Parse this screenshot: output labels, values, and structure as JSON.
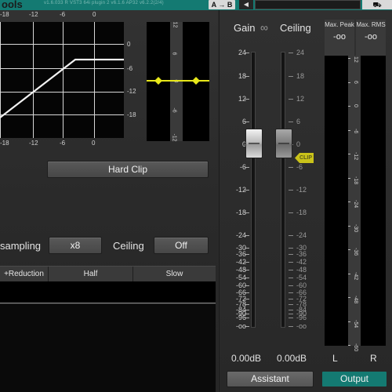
{
  "topbar": {
    "brand": "ools",
    "version": "v1.6.033 R VST3 64i plugin 2 v6.1.6 AP32 v6.2.2(2/4)",
    "ab_label": "A → B",
    "left_arrow": "◀",
    "save_icon": "⛟"
  },
  "transfer_graph": {
    "top_ticks": [
      "-18",
      "-12",
      "-6",
      "0"
    ],
    "bottom_ticks": [
      "-18",
      "-12",
      "-6",
      "0"
    ],
    "right_ticks": [
      "0",
      "-6",
      "-12",
      "-18"
    ]
  },
  "small_meter": {
    "ticks": [
      "12",
      "6",
      "0",
      "-6",
      "-12"
    ],
    "marker_color": "#e8e81a"
  },
  "clip_button": "Hard Clip",
  "oversampling": {
    "label": "sampling",
    "value": "x8"
  },
  "ceiling_switch": {
    "label": "Ceiling",
    "value": "Off"
  },
  "table_header": [
    "+Reduction",
    "Half",
    "Slow"
  ],
  "gain_ceiling": {
    "gain_label": "Gain",
    "link_icon": "∞",
    "ceiling_label": "Ceiling",
    "scale": [
      "24",
      "18",
      "12",
      "6",
      "0",
      "-6",
      "-12",
      "-18",
      "-24",
      "-30",
      "-36",
      "-42",
      "-48",
      "-54",
      "-60",
      "-66",
      "-72",
      "-78",
      "-84",
      "-90",
      "-96",
      "-oo"
    ],
    "gain_value": 0,
    "ceiling_value": 0,
    "gain_readout": "0.00dB",
    "ceiling_readout": "0.00dB",
    "clip_badge": "CLIP"
  },
  "output_meter": {
    "max_peak_label": "Max. Peak",
    "max_rms_label": "Max. RMS",
    "max_peak_value": "-oo",
    "max_rms_value": "-oo",
    "scale": [
      "12",
      "6",
      "0",
      "-6",
      "-12",
      "-18",
      "-24",
      "-30",
      "-36",
      "-42",
      "-48",
      "-54",
      "-60"
    ],
    "channel_left": "L",
    "channel_right": "R"
  },
  "buttons": {
    "assistant": "Assistant",
    "output": "Output"
  },
  "colors": {
    "accent_teal": "#147a72",
    "clip_yellow": "#c9c21a"
  }
}
